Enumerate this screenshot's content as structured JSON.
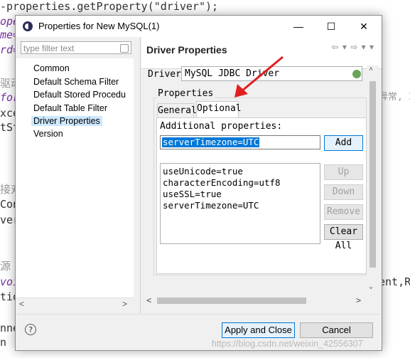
{
  "background_code": {
    "line1": "-properties.getProperty(\"driver\");",
    "line2": "ope",
    "line3": "me=",
    "line4": "rd=",
    "line5": "驱动",
    "line6": "for",
    "line7": "xce",
    "line8": "tSt",
    "line9": "接对",
    "line10": "Con",
    "line11": "ver",
    "line12": "源",
    "line13": "voi",
    "line14": "tio",
    "line15": "nne",
    "line16": "n",
    "right_line1": "异常, I",
    "right_line2": "ent,R"
  },
  "dialog": {
    "title": "Properties for New MySQL(1)",
    "minimize": "—",
    "maximize": "☐",
    "close": "✕"
  },
  "left": {
    "filter_placeholder": "type filter text",
    "items": [
      "Common",
      "Default Schema Filter",
      "Default Stored Procedu",
      "Default Table Filter",
      "Driver Properties",
      "Version"
    ]
  },
  "right": {
    "title": "Driver Properties",
    "nav": "⇦ ▾ ⇨ ▾ ▾",
    "drivers_label": "Drivers:",
    "drivers_value": "MySQL JDBC Driver",
    "properties_label": "Properties",
    "tabs": [
      "General",
      "Optional"
    ],
    "additional_label": "Additional properties:",
    "additional_value": "serverTimezone=UTC",
    "add_button": "Add",
    "properties_list": [
      "useUnicode=true",
      "characterEncoding=utf8",
      "useSSL=true",
      "serverTimezone=UTC"
    ],
    "up_button": "Up",
    "down_button": "Down",
    "remove_button": "Remove",
    "clear_button": "Clear All"
  },
  "footer": {
    "help": "?",
    "apply_close": "Apply and Close",
    "cancel": "Cancel"
  },
  "watermark": "https://blog.csdn.net/weixin_42556307",
  "colors": {
    "accent": "#0078d7",
    "arrow": "#e02020",
    "selection": "#cde8ff"
  }
}
